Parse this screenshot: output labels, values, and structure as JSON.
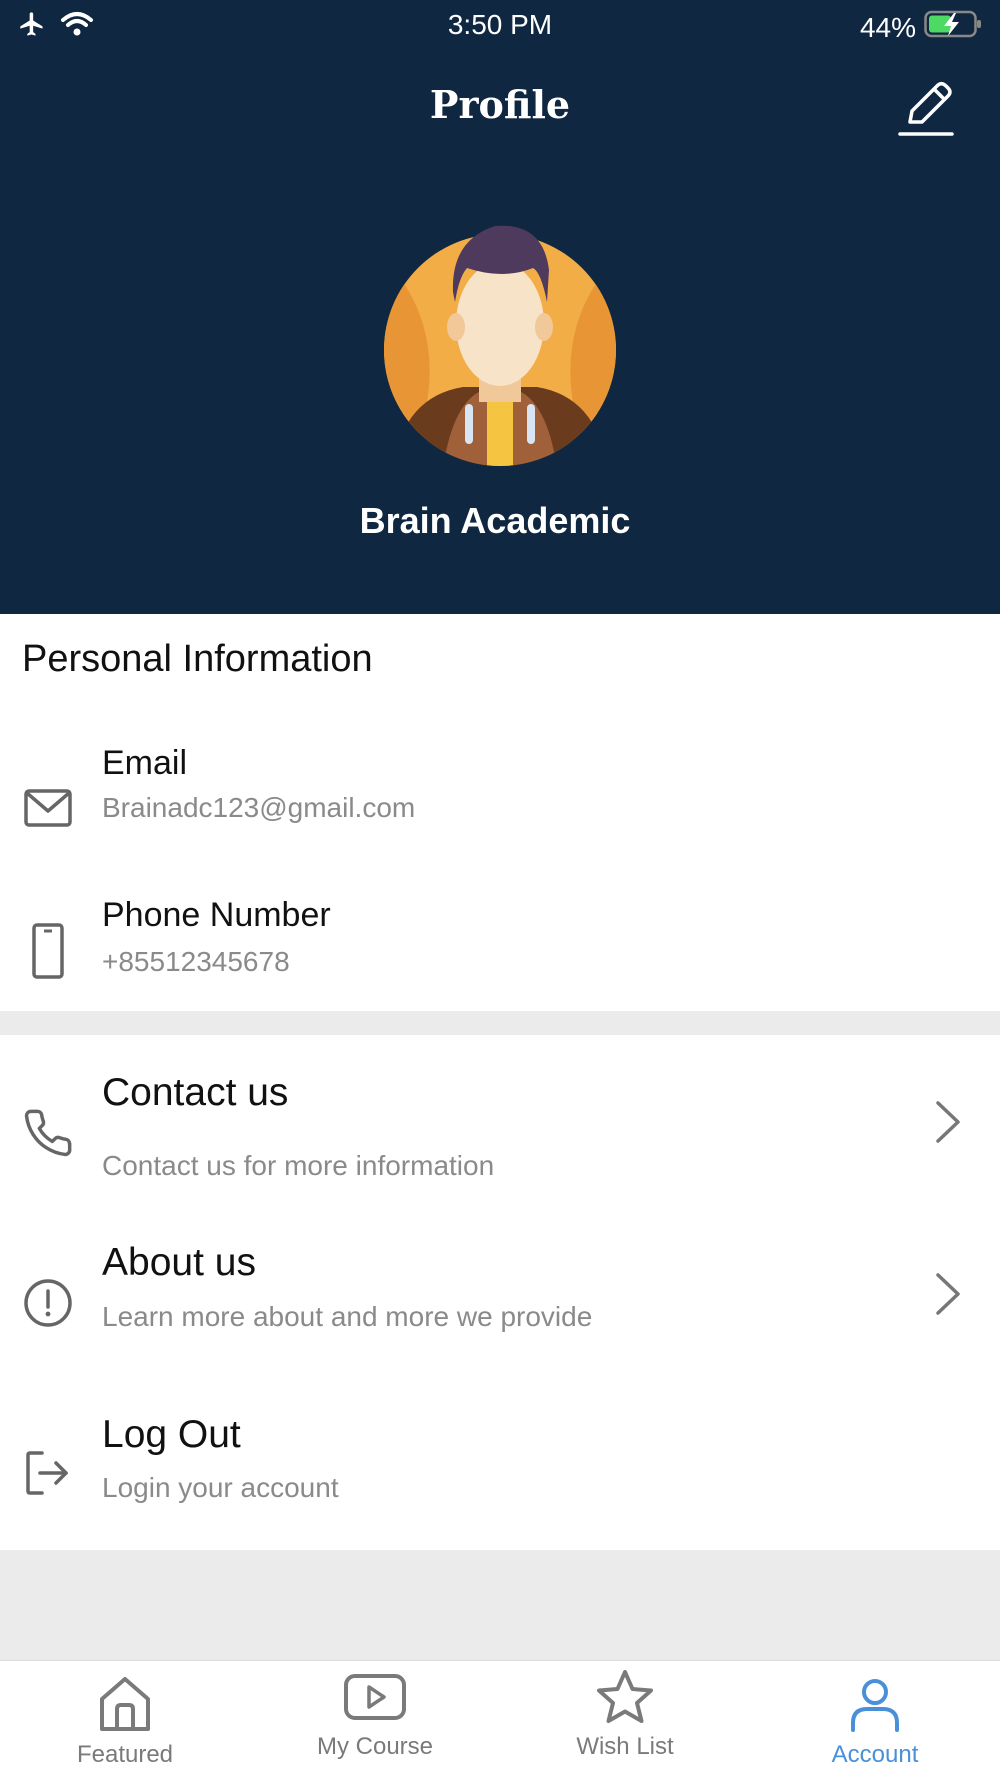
{
  "status_bar": {
    "time": "3:50 PM",
    "battery": "44%",
    "icons": [
      "airplane-icon",
      "wifi-icon",
      "battery-charging-icon"
    ]
  },
  "header": {
    "title": "Profile",
    "edit_icon": "pencil-icon"
  },
  "profile": {
    "name": "Brain Academic",
    "avatar": "user-avatar-illustration"
  },
  "personal_info": {
    "title": "Personal Information",
    "email": {
      "label": "Email",
      "value": "Brainadc123@gmail.com",
      "icon": "mail-icon"
    },
    "phone": {
      "label": "Phone Number",
      "value": "+85512345678",
      "icon": "smartphone-icon"
    }
  },
  "menu": [
    {
      "title": "Contact us",
      "subtitle": "Contact us for more information",
      "icon": "phone-icon"
    },
    {
      "title": "About us",
      "subtitle": "Learn more about and more we provide",
      "icon": "info-icon"
    },
    {
      "title": "Log Out",
      "subtitle": "Login your account",
      "icon": "logout-icon"
    }
  ],
  "tabs": [
    {
      "label": "Featured",
      "icon": "home-icon"
    },
    {
      "label": "My Course",
      "icon": "play-icon"
    },
    {
      "label": "Wish List",
      "icon": "star-icon"
    },
    {
      "label": "Account",
      "icon": "user-icon",
      "active": true
    }
  ],
  "colors": {
    "header_bg": "#0f2740",
    "accent": "#4a90d9",
    "secondary_text": "#8a8a8a",
    "battery_green": "#4cd964"
  }
}
